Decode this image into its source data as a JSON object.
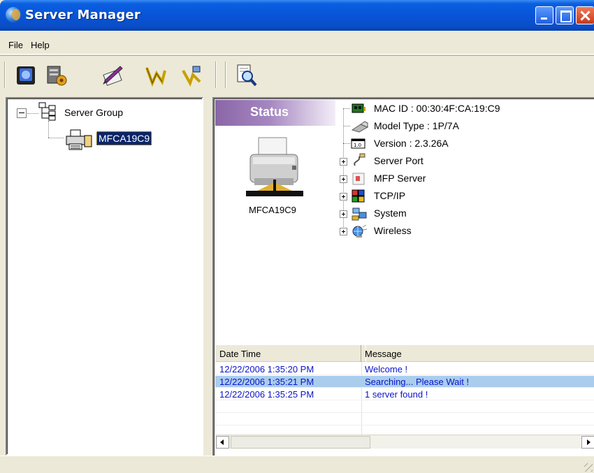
{
  "window": {
    "title": "Server Manager"
  },
  "menu": {
    "file": "File",
    "help": "Help"
  },
  "tree": {
    "root": "Server Group",
    "child": "MFCA19C9"
  },
  "status": {
    "banner": "Status",
    "device_name": "MFCA19C9",
    "mac_id": "MAC ID : 00:30:4F:CA:19:C9",
    "model_type": "Model Type : 1P/7A",
    "version": "Version : 2.3.26A",
    "server_port": "Server Port",
    "mfp_server": "MFP Server",
    "tcpip": "TCP/IP",
    "system": "System",
    "wireless": "Wireless",
    "version_badge": "1.0"
  },
  "log": {
    "col_datetime": "Date Time",
    "col_message": "Message",
    "rows": [
      {
        "datetime": "12/22/2006 1:35:20 PM",
        "message": "Welcome !"
      },
      {
        "datetime": "12/22/2006 1:35:21 PM",
        "message": "Searching... Please Wait !"
      },
      {
        "datetime": "12/22/2006 1:35:25 PM",
        "message": "1 server found !"
      }
    ]
  },
  "colors": {
    "titlebar": "#0854d8",
    "selection": "#0a246a",
    "log_text": "#0a14c8",
    "log_selected_row": "#aacdee",
    "status_banner": "#8a66a8"
  }
}
